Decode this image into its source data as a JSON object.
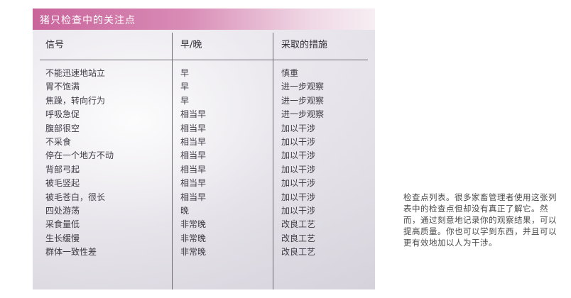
{
  "table": {
    "title": "猪只检查中的关注点",
    "headers": [
      "信号",
      "早/晚",
      "采取的措施"
    ],
    "rows": [
      [
        "不能迅速地站立",
        "早",
        "慎重"
      ],
      [
        "胃不饱满",
        "早",
        "进一步观察"
      ],
      [
        "焦躁，转向行为",
        "早",
        "进一步观察"
      ],
      [
        "呼吸急促",
        "相当早",
        "进一步观察"
      ],
      [
        "腹部很空",
        "相当早",
        "加以干涉"
      ],
      [
        "不采食",
        "相当早",
        "加以干涉"
      ],
      [
        "停在一个地方不动",
        "相当早",
        "加以干涉"
      ],
      [
        "背部弓起",
        "相当早",
        "加以干涉"
      ],
      [
        "被毛竖起",
        "相当早",
        "加以干涉"
      ],
      [
        "被毛苍白，很长",
        "相当早",
        "加以干涉"
      ],
      [
        "四处游荡",
        "晚",
        "加以干涉"
      ],
      [
        "采食量低",
        "非常晚",
        "改良工艺"
      ],
      [
        "生长缓慢",
        "非常晚",
        "改良工艺"
      ],
      [
        "群体一致性差",
        "非常晚",
        "改良工艺"
      ]
    ]
  },
  "caption": "检查点列表。很多家畜管理者使用这张列表中的检查点但却没有真正了解它。然而，通过刻意地记录你的观察结果，可以提高质量。你也可以学到东西，并且可以更有效地加以人为干涉。",
  "colors": {
    "title_bar": "#c9649b",
    "rules": "#6d6872"
  }
}
